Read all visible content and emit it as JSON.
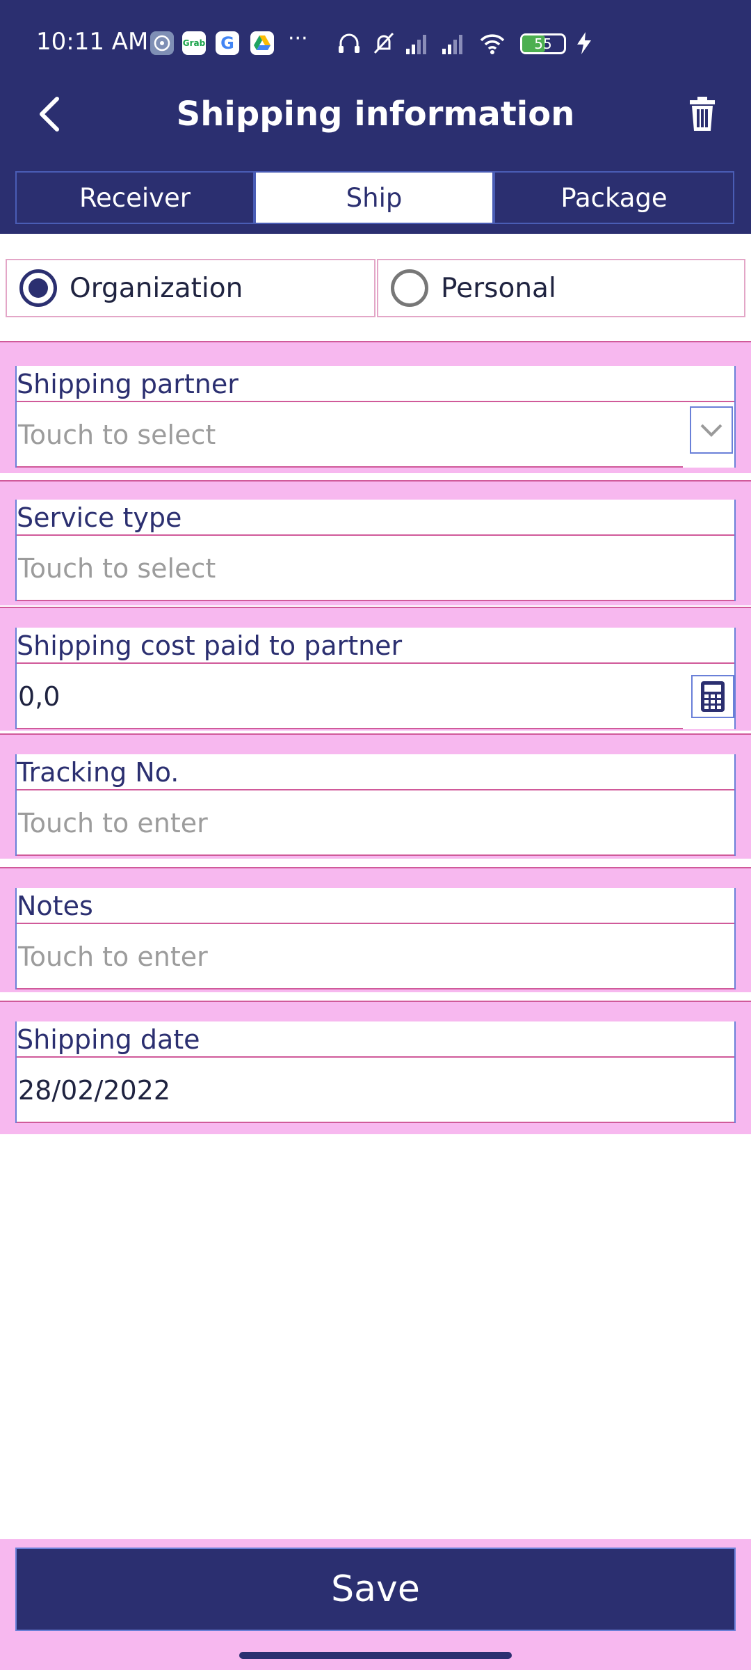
{
  "status_bar": {
    "time": "10:11 AM",
    "battery": "55",
    "icons": [
      "assistant-icon",
      "grab-icon",
      "google-icon",
      "drive-icon",
      "more-dots-icon",
      "headset-icon",
      "mute-icon",
      "signal-icon",
      "signal-icon",
      "wifi-icon",
      "battery-icon",
      "charging-icon"
    ]
  },
  "app_bar": {
    "title": "Shipping information",
    "back_icon": "back-arrow-icon",
    "delete_icon": "trash-icon"
  },
  "tabs": [
    {
      "label": "Receiver",
      "active": false
    },
    {
      "label": "Ship",
      "active": true
    },
    {
      "label": "Package",
      "active": false
    }
  ],
  "sender_type": {
    "options": [
      {
        "label": "Organization",
        "selected": true
      },
      {
        "label": "Personal",
        "selected": false
      }
    ]
  },
  "fields": {
    "shipping_partner": {
      "label": "Shipping partner",
      "placeholder": "Touch to select",
      "icon": "chevron-down-icon"
    },
    "service_type": {
      "label": "Service type",
      "placeholder": "Touch to select"
    },
    "shipping_cost": {
      "label": "Shipping cost paid to partner",
      "value": "0,0",
      "icon": "calculator-icon"
    },
    "tracking_no": {
      "label": "Tracking No.",
      "placeholder": "Touch to enter"
    },
    "notes": {
      "label": "Notes",
      "placeholder": "Touch to enter"
    },
    "shipping_date": {
      "label": "Shipping date",
      "value": "28/02/2022"
    }
  },
  "actions": {
    "save_label": "Save"
  },
  "colors": {
    "primary": "#2b2f70",
    "highlight": "#f7b8ef",
    "placeholder": "#9c9c9c"
  }
}
